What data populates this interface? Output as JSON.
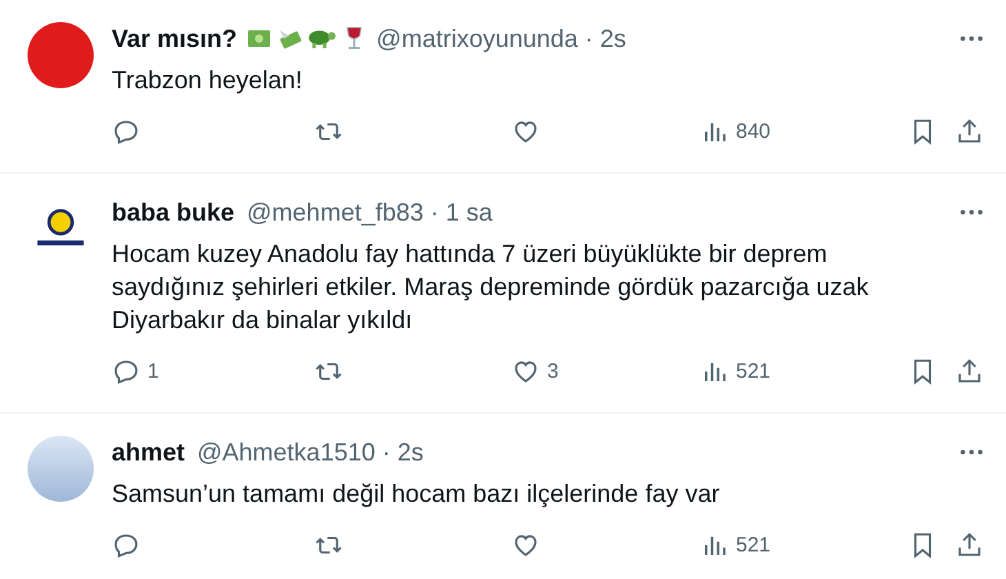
{
  "tweets": [
    {
      "avatar": {
        "kind": "red"
      },
      "display_name": "Var mısın?",
      "name_emojis": [
        {
          "kind": "banknote"
        },
        {
          "kind": "flying-money"
        },
        {
          "kind": "turtle"
        },
        {
          "kind": "wine"
        }
      ],
      "handle_time": "@matrixoyununda · 2s",
      "text_lines": [
        "Trabzon heyelan!"
      ],
      "views": "840"
    },
    {
      "avatar": {
        "kind": "logo"
      },
      "display_name": "baba buke",
      "handle_time": "@mehmet_fb83 · 1 sa",
      "text_lines": [
        "Hocam kuzey Anadolu fay hattında 7 üzeri büyüklükte bir deprem",
        "saydığınız şehirleri etkiler. Maraş depreminde gördük pazarcığa uzak",
        "Diyarbakır da binalar yıkıldı"
      ],
      "replies": "1",
      "likes": "3",
      "views": "521"
    },
    {
      "avatar": {
        "kind": "photo"
      },
      "display_name": "ahmet",
      "handle_time": "@Ahmetka1510 · 2s",
      "text_lines": [
        "Samsun’un tamamı değil hocam bazı ilçelerinde fay var"
      ],
      "views": "521"
    }
  ]
}
